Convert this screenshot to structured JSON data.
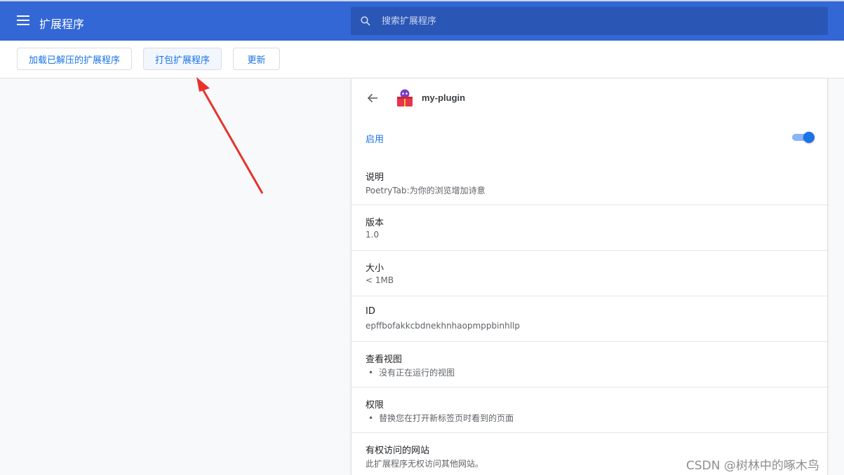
{
  "header": {
    "title": "扩展程序",
    "menu_icon": "hamburger-menu-icon",
    "search": {
      "placeholder": "搜索扩展程序",
      "icon": "search-icon"
    }
  },
  "toolbar": {
    "load_unpacked_label": "加载已解压的扩展程序",
    "pack_label": "打包扩展程序",
    "update_label": "更新"
  },
  "detail": {
    "back_icon": "back-arrow-icon",
    "name": "my-plugin",
    "enabled_label": "启用",
    "enabled": true,
    "sections": {
      "description": {
        "label": "说明",
        "value": "PoetryTab:为你的浏览增加诗意"
      },
      "version": {
        "label": "版本",
        "value": "1.0"
      },
      "size": {
        "label": "大小",
        "value": "< 1MB"
      },
      "id": {
        "label": "ID",
        "value": "epffbofakkcbdnekhnhaopmppbinhllp"
      },
      "views": {
        "label": "查看视图",
        "item": "没有正在运行的视图"
      },
      "permissions": {
        "label": "权限",
        "item": "替换您在打开新标签页时看到的页面"
      },
      "site_access": {
        "label": "有权访问的网站",
        "value": "此扩展程序无权访问其他网站。"
      }
    }
  },
  "watermark": "CSDN @树林中的啄木鸟",
  "colors": {
    "header": "#3367d6",
    "accent": "#1a73e8",
    "annotation_arrow": "#e8322d"
  }
}
